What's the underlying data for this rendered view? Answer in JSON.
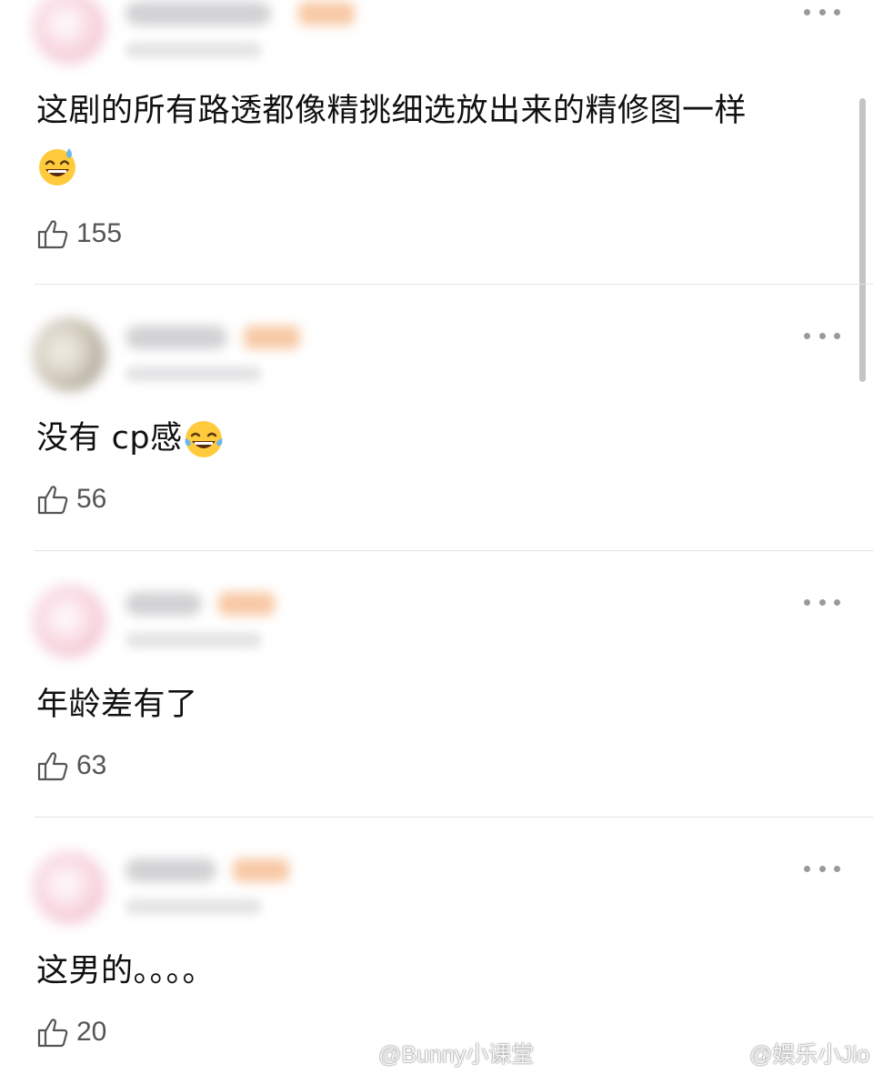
{
  "comments": [
    {
      "text": "这剧的所有路透都像精挑细选放出来的精修图一样",
      "emoji": "sweat-smile-emoji",
      "likes": "155"
    },
    {
      "text": "没有 cp感",
      "emoji": "tears-of-joy-emoji",
      "likes": "56"
    },
    {
      "text": "年龄差有了",
      "likes": "63"
    },
    {
      "text": "这男的。。。。",
      "likes": "20"
    }
  ],
  "watermarks": [
    "@Bunny小课堂",
    "@娱乐小Jio"
  ],
  "colors": {
    "text": "#111111",
    "like_count": "#555555",
    "divider": "#e2e2e2",
    "tag_blur": "#f8c9a6"
  }
}
